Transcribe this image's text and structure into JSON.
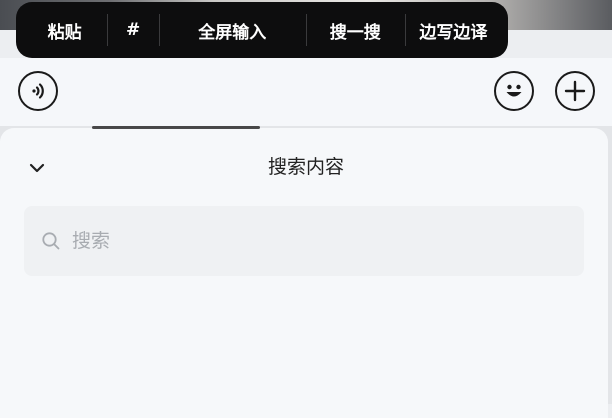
{
  "context_menu": {
    "items": [
      {
        "label": "粘贴"
      },
      {
        "label": "#"
      },
      {
        "label": "全屏输入"
      },
      {
        "label": "搜一搜"
      },
      {
        "label": "边写边译"
      }
    ]
  },
  "input_bar": {
    "icons": {
      "voice": "voice-icon",
      "emoji": "emoji-icon",
      "plus": "plus-icon"
    }
  },
  "search_panel": {
    "title": "搜索内容",
    "search": {
      "placeholder": "搜索",
      "value": ""
    },
    "icons": {
      "collapse": "chevron-down-icon",
      "search": "search-icon"
    }
  },
  "colors": {
    "menu_background": "#0d0d0e",
    "menu_text": "#ffffff",
    "panel_background": "#f6f8fa",
    "search_box_background": "#eff1f3",
    "placeholder": "#a8acb1",
    "icon_stroke": "#1a1a1a"
  }
}
